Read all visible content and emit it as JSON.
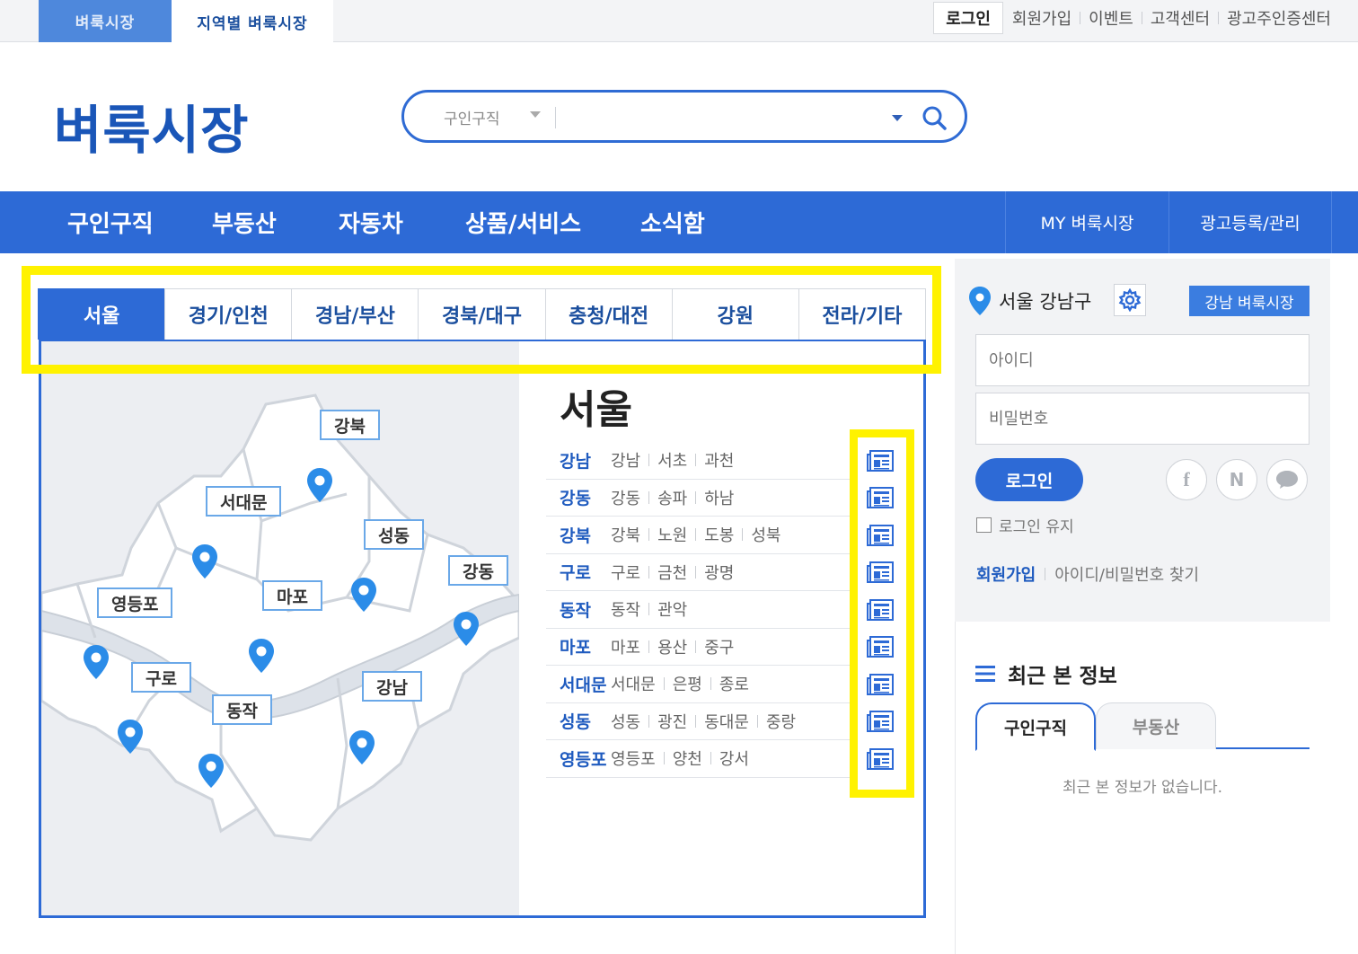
{
  "topbar": {
    "site_tab_main": "벼룩시장",
    "site_tab_region": "지역별 벼룩시장",
    "util_links": [
      "로그인",
      "회원가입",
      "이벤트",
      "고객센터",
      "광고주인증센터"
    ]
  },
  "header": {
    "logo": "벼룩시장",
    "search": {
      "category": "구인구직",
      "query": "",
      "placeholder": ""
    }
  },
  "gnb": {
    "items": [
      "구인구직",
      "부동산",
      "자동차",
      "상품/서비스",
      "소식함"
    ],
    "right": [
      "MY 벼룩시장",
      "광고등록/관리"
    ]
  },
  "region_tabs": [
    "서울",
    "경기/인천",
    "경남/부산",
    "경북/대구",
    "충청/대전",
    "강원",
    "전라/기타"
  ],
  "region_active": "서울",
  "panel": {
    "title": "서울",
    "districts": [
      {
        "name": "강남",
        "subs": [
          "강남",
          "서초",
          "과천"
        ]
      },
      {
        "name": "강동",
        "subs": [
          "강동",
          "송파",
          "하남"
        ]
      },
      {
        "name": "강북",
        "subs": [
          "강북",
          "노원",
          "도봉",
          "성북"
        ]
      },
      {
        "name": "구로",
        "subs": [
          "구로",
          "금천",
          "광명"
        ]
      },
      {
        "name": "동작",
        "subs": [
          "동작",
          "관악"
        ]
      },
      {
        "name": "마포",
        "subs": [
          "마포",
          "용산",
          "중구"
        ]
      },
      {
        "name": "서대문",
        "subs": [
          "서대문",
          "은평",
          "종로"
        ]
      },
      {
        "name": "성동",
        "subs": [
          "성동",
          "광진",
          "동대문",
          "중랑"
        ]
      },
      {
        "name": "영등포",
        "subs": [
          "영등포",
          "양천",
          "강서"
        ]
      }
    ]
  },
  "map": {
    "labels": [
      "강북",
      "서대문",
      "성동",
      "강동",
      "영등포",
      "마포",
      "구로",
      "강남",
      "동작"
    ]
  },
  "sidebar": {
    "location": "서울 강남구",
    "market_button": "강남 벼룩시장",
    "id_placeholder": "아이디",
    "pw_placeholder": "비밀번호",
    "login_button": "로그인",
    "sns": [
      "f",
      "N",
      "💬"
    ],
    "keep_login": "로그인 유지",
    "join": "회원가입",
    "find": "아이디/비밀번호 찾기",
    "recent_title": "최근 본 정보",
    "recent_tabs": [
      "구인구직",
      "부동산"
    ],
    "recent_empty": "최근 본 정보가 없습니다."
  },
  "colors": {
    "primary": "#2d6ad6",
    "highlight": "#fff200",
    "pin": "#2b8ce8"
  }
}
